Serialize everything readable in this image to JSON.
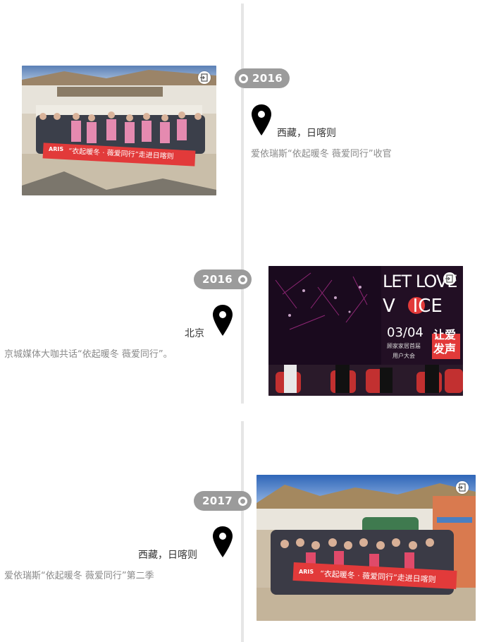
{
  "timeline": {
    "entries": [
      {
        "year": "2016",
        "location": "西藏，日喀则",
        "description": "爱依瑞斯“依起暖冬 薇爱同行”收官",
        "banner_text": "“衣起暖冬 · 薇爱同行”走进日喀则",
        "brand_text": "ARIS"
      },
      {
        "year": "2016",
        "location": "北京",
        "description": "京城媒体大咖共话“依起暖冬 薇爱同行”。",
        "stage_title_1": "LET LOVE",
        "stage_title_2": "V   ICE",
        "stage_date": "03/04",
        "stage_slogan_1": "让爱",
        "stage_slogan_2": "发声",
        "stage_sub": "顾家家居首届",
        "stage_sub2": "用户大会"
      },
      {
        "year": "2017",
        "location": "西藏，日喀则",
        "description": "爱依瑞斯“依起暖冬 薇爱同行”第二季",
        "banner_text": "“衣起暖冬 · 薇爱同行”走进日喀则",
        "brand_text": "ARIS"
      }
    ]
  },
  "colors": {
    "badge": "#9b9b9b",
    "line": "#e6e6e6",
    "banner_red": "#e23a3a"
  },
  "icons": {
    "export": "export-icon",
    "pin": "location-pin-icon"
  }
}
